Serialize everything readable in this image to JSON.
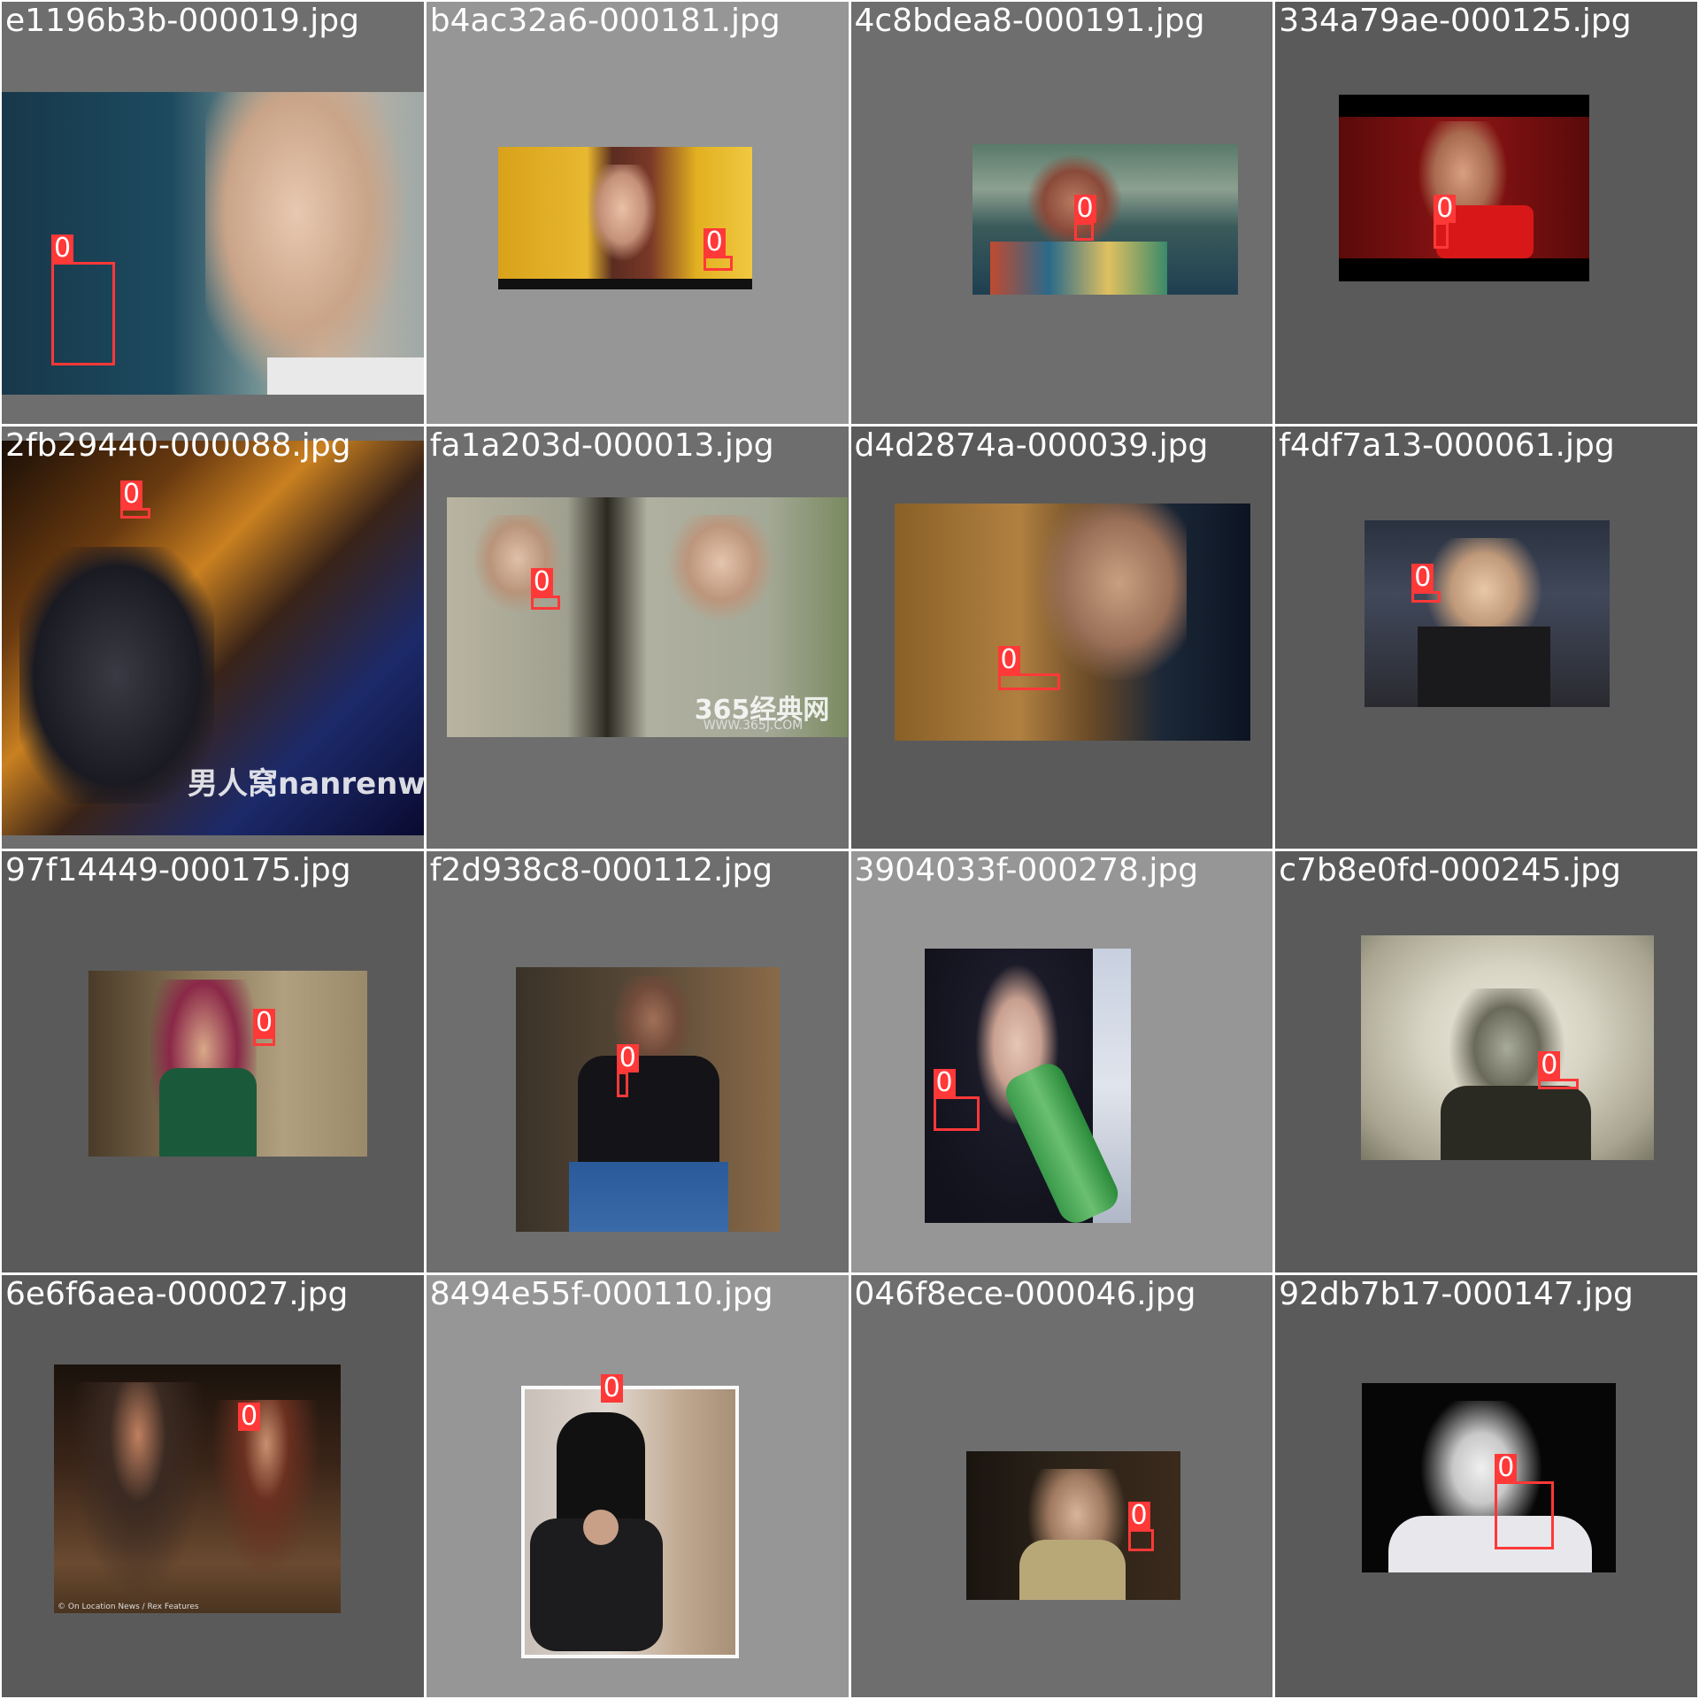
{
  "colors": {
    "box": "#ff3838",
    "label": "#ffffff",
    "tile_dark": "#5a5a5a",
    "tile_mid": "#6e6e6e",
    "tile_light": "#969696"
  },
  "tiles": [
    {
      "filename": "e1196b3b-000019.jpg",
      "box_label": "0"
    },
    {
      "filename": "b4ac32a6-000181.jpg",
      "box_label": "0"
    },
    {
      "filename": "4c8bdea8-000191.jpg",
      "box_label": "0"
    },
    {
      "filename": "334a79ae-000125.jpg",
      "box_label": "0"
    },
    {
      "filename": "2fb29440-000088.jpg",
      "box_label": "0",
      "watermark": "男人窝nanrenwo"
    },
    {
      "filename": "fa1a203d-000013.jpg",
      "box_label": "0",
      "watermark": "365经典网",
      "watermark_sub": "WWW.365J.COM"
    },
    {
      "filename": "d4d2874a-000039.jpg",
      "box_label": "0"
    },
    {
      "filename": "f4df7a13-000061.jpg",
      "box_label": "0"
    },
    {
      "filename": "97f14449-000175.jpg",
      "box_label": "0"
    },
    {
      "filename": "f2d938c8-000112.jpg",
      "box_label": "0"
    },
    {
      "filename": "3904033f-000278.jpg",
      "box_label": "0"
    },
    {
      "filename": "c7b8e0fd-000245.jpg",
      "box_label": "0"
    },
    {
      "filename": "6e6f6aea-000027.jpg",
      "box_label": "0",
      "credit": "© On Location News / Rex Features"
    },
    {
      "filename": "8494e55f-000110.jpg",
      "box_label": "0"
    },
    {
      "filename": "046f8ece-000046.jpg",
      "box_label": "0"
    },
    {
      "filename": "92db7b17-000147.jpg",
      "box_label": "0"
    }
  ]
}
